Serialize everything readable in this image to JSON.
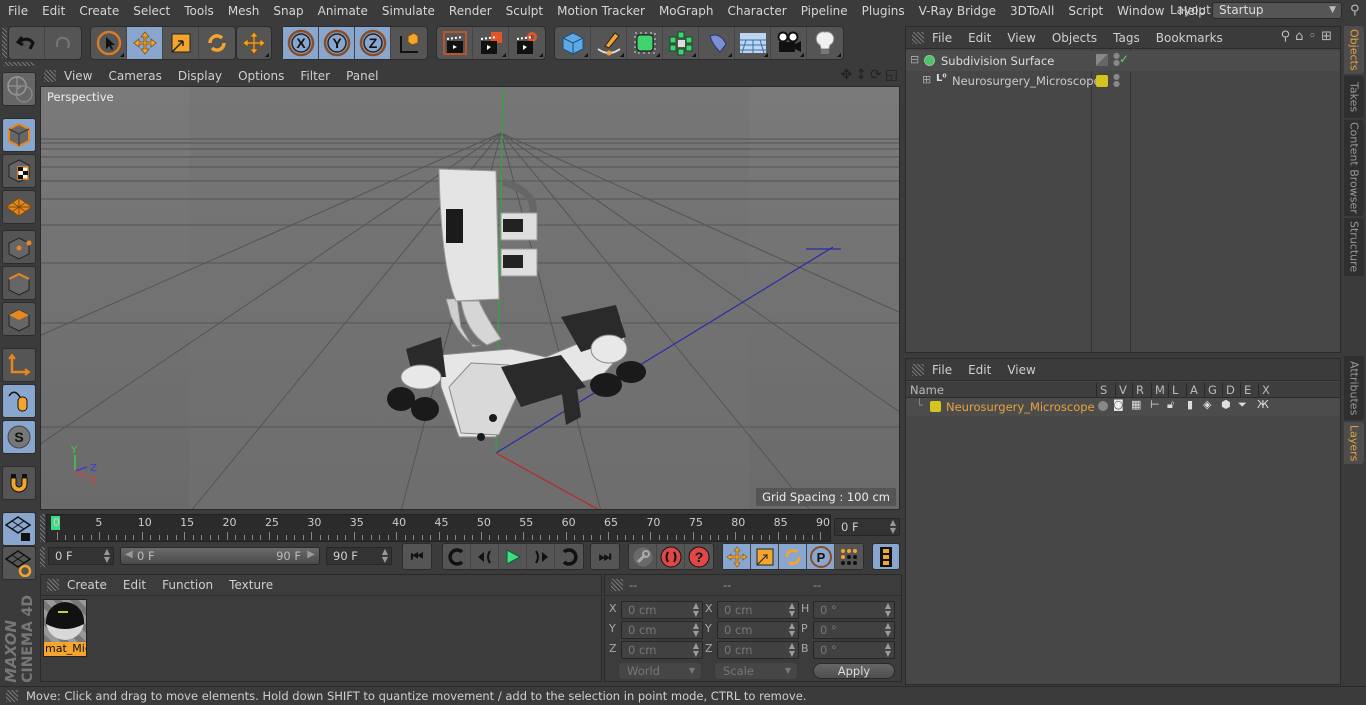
{
  "menubar": {
    "items": [
      "File",
      "Edit",
      "Create",
      "Select",
      "Tools",
      "Mesh",
      "Snap",
      "Animate",
      "Simulate",
      "Render",
      "Sculpt",
      "Motion Tracker",
      "MoGraph",
      "Character",
      "Pipeline",
      "Plugins",
      "V-Ray Bridge",
      "3DToAll",
      "Script",
      "Window",
      "Help"
    ],
    "layout_label": "Layout:",
    "layout_value": "Startup"
  },
  "toolbar": {
    "groups": [
      {
        "name": "history",
        "buttons": [
          "undo-icon",
          "redo-icon"
        ]
      },
      {
        "name": "tools",
        "buttons": [
          "live-selection-icon",
          "move-icon",
          "scale-icon",
          "rotate-icon"
        ]
      },
      {
        "name": "recent",
        "buttons": [
          "move-recent-icon"
        ]
      },
      {
        "name": "axis",
        "buttons": [
          "x-axis-icon",
          "y-axis-icon",
          "z-axis-icon",
          "coordinate-system-icon"
        ]
      },
      {
        "name": "render",
        "buttons": [
          "render-view-icon",
          "render-picture-viewer-icon",
          "render-settings-icon"
        ]
      },
      {
        "name": "create",
        "buttons": [
          "cube-icon",
          "pen-spline-icon",
          "subdivision-icon",
          "cloner-icon",
          "deformer-icon",
          "floor-icon",
          "camera-icon",
          "light-icon"
        ]
      }
    ],
    "active": [
      "move-icon",
      "x-axis-icon",
      "y-axis-icon",
      "z-axis-icon"
    ]
  },
  "left_toolbar": {
    "buttons": [
      "make-editable-icon",
      "model-mode-icon",
      "texture-mode-icon",
      "workplane-mode-icon",
      "points-mode-icon",
      "edges-mode-icon",
      "polygons-mode-icon",
      "axis-mode-icon",
      "tweak-mode-icon",
      "solo-icon",
      "snap-icon",
      "lock-workplane-icon",
      "workplane-align-icon"
    ],
    "active": [
      "model-mode-icon",
      "tweak-mode-icon",
      "solo-icon",
      "lock-workplane-icon"
    ]
  },
  "viewport": {
    "menu": [
      "View",
      "Cameras",
      "Display",
      "Options",
      "Filter",
      "Panel"
    ],
    "camera_label": "Perspective",
    "grid_spacing": "Grid Spacing : 100 cm",
    "axis_labels": {
      "x": "X",
      "y": "Y",
      "z": "Z"
    },
    "nav_icons": [
      "pan-icon",
      "dolly-icon",
      "orbit-icon",
      "maximize-icon"
    ]
  },
  "timeline": {
    "ticks": [
      "0",
      "5",
      "10",
      "15",
      "20",
      "25",
      "30",
      "35",
      "40",
      "45",
      "50",
      "55",
      "60",
      "65",
      "70",
      "75",
      "80",
      "85",
      "90"
    ],
    "current_frame_field": "0 F",
    "start_field": "0 F",
    "range_start": "0 F",
    "range_end": "90 F",
    "end_field": "90 F",
    "playhead_frame": 0,
    "max_frame": 90
  },
  "transport": {
    "buttons": [
      "go-to-start-icon",
      "prev-keyframe-icon",
      "prev-frame-icon",
      "play-icon",
      "next-frame-icon",
      "next-keyframe-icon",
      "go-to-end-icon"
    ],
    "key_buttons": [
      "motion-path-icon",
      "record-icon",
      "autokey-icon"
    ],
    "key_tracks": [
      "key-position-icon",
      "key-scale-icon",
      "key-rotation-icon",
      "key-param-icon",
      "key-pla-icon"
    ],
    "timeline_button": "timeline-icon"
  },
  "materials": {
    "menu": [
      "Create",
      "Edit",
      "Function",
      "Texture"
    ],
    "items": [
      {
        "name": "mat_Mic",
        "selected": true
      }
    ]
  },
  "coordinates": {
    "headers": [
      "--",
      "--",
      "--"
    ],
    "rows": [
      {
        "l1": "X",
        "v1": "0 cm",
        "l2": "X",
        "v2": "0 cm",
        "l3": "H",
        "v3": "0 °"
      },
      {
        "l1": "Y",
        "v1": "0 cm",
        "l2": "Y",
        "v2": "0 cm",
        "l3": "P",
        "v3": "0 °"
      },
      {
        "l1": "Z",
        "v1": "0 cm",
        "l2": "Z",
        "v2": "0 cm",
        "l3": "B",
        "v3": "0 °"
      }
    ],
    "mode_select": "World",
    "type_select": "Scale",
    "apply_label": "Apply"
  },
  "objects": {
    "menu": [
      "File",
      "Edit",
      "View",
      "Objects",
      "Tags",
      "Bookmarks"
    ],
    "tree": [
      {
        "name": "Subdivision Surface",
        "level": 0,
        "expanded": true,
        "color": "#4fc36b"
      },
      {
        "name": "Neurosurgery_Microscope",
        "level": 1,
        "expanded": false,
        "color": "#d4c51e"
      }
    ]
  },
  "layers": {
    "menu": [
      "File",
      "Edit",
      "View"
    ],
    "columns": [
      "Name",
      "S",
      "V",
      "R",
      "M",
      "L",
      "A",
      "G",
      "D",
      "E",
      "X"
    ],
    "rows": [
      {
        "name": "Neurosurgery_Microscope",
        "color": "#d4c51e"
      }
    ]
  },
  "side_tabs": {
    "top": [
      "Objects",
      "Takes",
      "Content Browser",
      "Structure"
    ],
    "bottom": [
      "Attributes",
      "Layers"
    ],
    "active": [
      "Objects",
      "Layers"
    ]
  },
  "brand": {
    "maxon": "MAXON",
    "product": "CINEMA 4D"
  },
  "status": "Move: Click and drag to move elements. Hold down SHIFT to quantize movement / add to the selection in point mode, CTRL to remove.",
  "colors": {
    "accent": "#e8a33a",
    "active_button": "#89a6cf",
    "layer_yellow": "#d4c51e",
    "play_green": "#3ddc84"
  }
}
